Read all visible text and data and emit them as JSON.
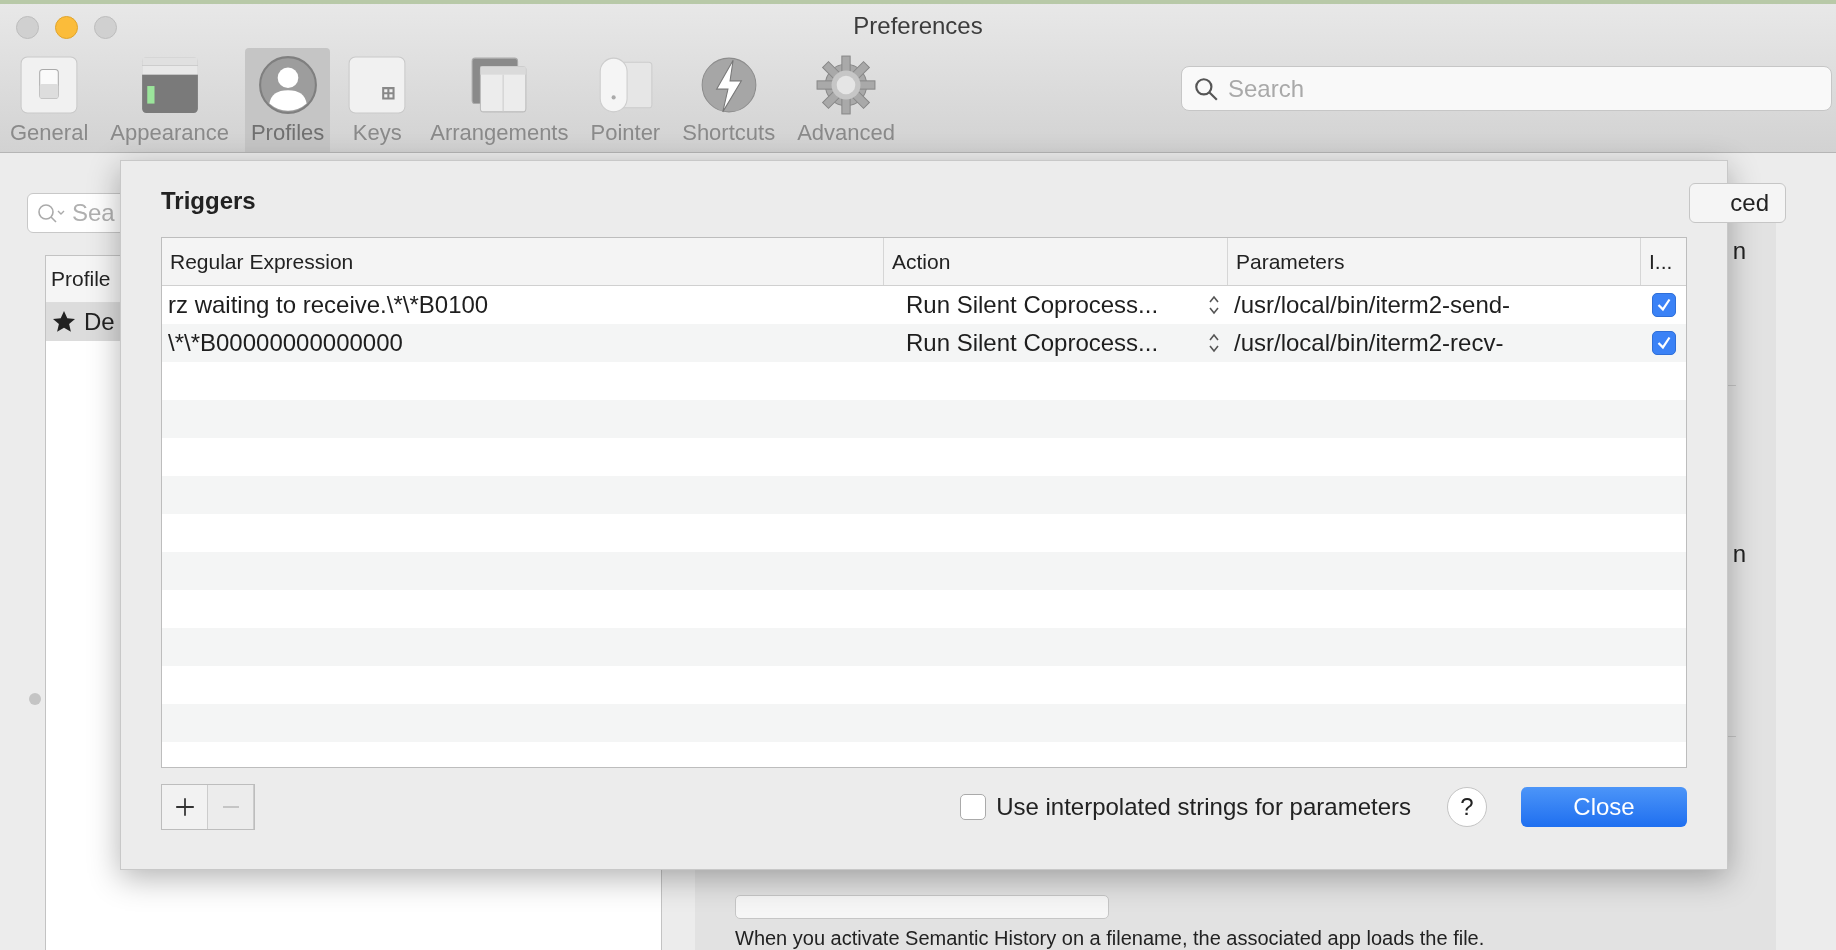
{
  "window": {
    "title": "Preferences"
  },
  "toolbar": {
    "tabs": [
      {
        "label": "General",
        "selected": false
      },
      {
        "label": "Appearance",
        "selected": false
      },
      {
        "label": "Profiles",
        "selected": true
      },
      {
        "label": "Keys",
        "selected": false
      },
      {
        "label": "Arrangements",
        "selected": false
      },
      {
        "label": "Pointer",
        "selected": false
      },
      {
        "label": "Shortcuts",
        "selected": false
      },
      {
        "label": "Advanced",
        "selected": false
      }
    ],
    "search": {
      "placeholder": "Search"
    }
  },
  "profiles_pane": {
    "search": {
      "placeholder": "Sea"
    },
    "column": "Profile",
    "rows": [
      {
        "label": "De",
        "selected": true
      }
    ]
  },
  "details_pane": {
    "tab": "ced",
    "fragments": [
      "n",
      "n"
    ],
    "note": "When you activate Semantic History on a filename, the associated app loads the file."
  },
  "sheet": {
    "title": "Triggers",
    "table": {
      "columns": [
        "Regular Expression",
        "Action",
        "Parameters",
        "I..."
      ],
      "rows": [
        {
          "regex": "rz waiting to receive.\\*\\*B0100",
          "action": "Run Silent Coprocess...",
          "parameters": "/usr/local/bin/iterm2-send-",
          "enabled": true
        },
        {
          "regex": "\\*\\*B00000000000000",
          "action": "Run Silent Coprocess...",
          "parameters": "/usr/local/bin/iterm2-recv-",
          "enabled": true
        }
      ]
    },
    "remove_disabled": true,
    "interpolated": {
      "label": "Use interpolated strings for parameters",
      "checked": false
    },
    "help": "?",
    "close": "Close"
  }
}
